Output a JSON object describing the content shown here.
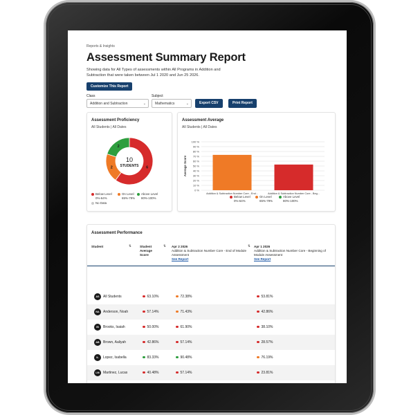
{
  "breadcrumb": "Reports & Insights",
  "title": "Assessment Summary Report",
  "description": "Showing data for All Types of assessments within All Programs in Addition and Subtraction that were taken between Jul 1 2020 and Jun 25 2026.",
  "customize_label": "Customize This Report",
  "filters": {
    "class_label": "Class",
    "class_value": "Addition and Subtraction",
    "subject_label": "Subject",
    "subject_value": "Mathematics",
    "export_label": "Export CSV",
    "print_label": "Print Report"
  },
  "colors": {
    "below": "#d62b2b",
    "on": "#ef7a26",
    "above": "#2e9e3e",
    "nodata": "#c8c8c8",
    "brand": "#17406d"
  },
  "proficiency": {
    "title": "Assessment Proficiency",
    "subtitle": "All Students | All Dates",
    "center_number": "10",
    "center_label": "STUDENTS",
    "chart_data": {
      "type": "pie",
      "categories": [
        "Below Level",
        "On Level",
        "Above Level",
        "No Data"
      ],
      "values": [
        6,
        2,
        2,
        0
      ]
    },
    "slice_labels": [
      "6",
      "2",
      "2"
    ],
    "legend": [
      {
        "name": "Below Level",
        "range": "0%-64%"
      },
      {
        "name": "On Level",
        "range": "65%-79%"
      },
      {
        "name": "Above Level",
        "range": "80%-100%"
      },
      {
        "name": "No Data",
        "range": ""
      }
    ]
  },
  "average": {
    "title": "Assessment Average",
    "subtitle": "All Students | All Dates",
    "ylabel": "Average Score",
    "yticks": [
      "100 %",
      "90 %",
      "80 %",
      "70 %",
      "60 %",
      "50 %",
      "40 %",
      "30 %",
      "20 %",
      "10 %",
      "0 %"
    ],
    "chart_data": {
      "type": "bar",
      "categories": [
        "Addition & Subtraction Number Core - End...",
        "Addition & Subtraction Number Core - Beg..."
      ],
      "values": [
        73,
        53
      ],
      "ylim": [
        0,
        100
      ]
    },
    "legend": [
      {
        "name": "Below Level",
        "range": "0%-64%"
      },
      {
        "name": "On Level",
        "range": "65%-79%"
      },
      {
        "name": "Above Level",
        "range": "80%-100%"
      }
    ]
  },
  "performance": {
    "title": "Assessment Performance",
    "col_student": "Student",
    "col_avg": "Student Average Score",
    "col_a_date": "Apr 2 2026",
    "col_a_name": "Addition & Subtraction Number Core - End of Module Assessment",
    "col_b_date": "Apr 1 2026",
    "col_b_name": "Addition & Subtraction Number Core - Beginning of Module Assessment",
    "see_report": "See Report",
    "rows": [
      {
        "initials": "AS",
        "name": "All Students",
        "avg": "63.10%",
        "avg_level": "below",
        "a": "72.38%",
        "a_level": "on",
        "b": "53.81%",
        "b_level": "below"
      },
      {
        "initials": "NA",
        "name": "Anderson, Noah",
        "avg": "57.14%",
        "avg_level": "below",
        "a": "71.43%",
        "a_level": "on",
        "b": "42.86%",
        "b_level": "below"
      },
      {
        "initials": "IB",
        "name": "Brooks, Isaiah",
        "avg": "50.00%",
        "avg_level": "below",
        "a": "61.90%",
        "a_level": "below",
        "b": "38.10%",
        "b_level": "below"
      },
      {
        "initials": "AB",
        "name": "Brown, Aaliyah",
        "avg": "42.86%",
        "avg_level": "below",
        "a": "57.14%",
        "a_level": "below",
        "b": "28.57%",
        "b_level": "below"
      },
      {
        "initials": "IL",
        "name": "Lopez, Isabella",
        "avg": "83.33%",
        "avg_level": "above",
        "a": "90.48%",
        "a_level": "above",
        "b": "76.19%",
        "b_level": "on"
      },
      {
        "initials": "LM",
        "name": "Martinez, Lucas",
        "avg": "40.48%",
        "avg_level": "below",
        "a": "57.14%",
        "a_level": "below",
        "b": "23.81%",
        "b_level": "below"
      }
    ]
  }
}
